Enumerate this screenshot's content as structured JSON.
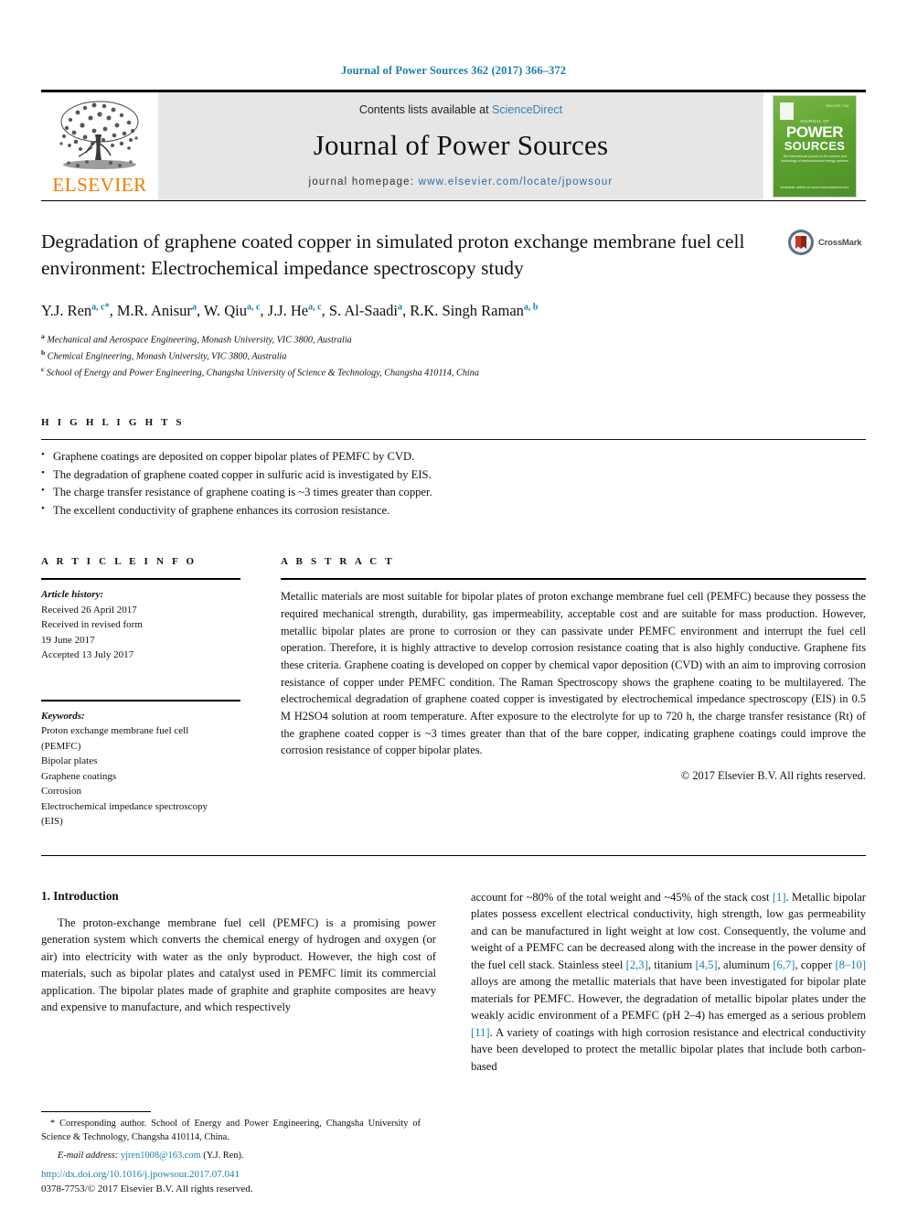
{
  "running_head": "Journal of Power Sources 362 (2017) 366–372",
  "masthead": {
    "publisher_name": "ELSEVIER",
    "contents_prefix": "Contents lists available at ",
    "contents_link": "ScienceDirect",
    "journal_name": "Journal of Power Sources",
    "homepage_prefix": "journal homepage: ",
    "homepage_url": "www.elsevier.com/locate/jpowsour",
    "cover": {
      "issn_line": "ISSN 0378-7753",
      "kicker": "JOURNAL OF",
      "word_power": "POWER",
      "word_sources": "SOURCES",
      "subtitle": "The international journal on the science and technology of electrochemical energy systems",
      "footer": "Available online at www.sciencedirect.com"
    }
  },
  "article": {
    "title": "Degradation of graphene coated copper in simulated proton exchange membrane fuel cell environment: Electrochemical impedance spectroscopy study",
    "crossmark_label": "CrossMark",
    "authors": [
      {
        "name": "Y.J. Ren",
        "marks": "a, c",
        "star": true
      },
      {
        "name": "M.R. Anisur",
        "marks": "a",
        "star": false
      },
      {
        "name": "W. Qiu",
        "marks": "a, c",
        "star": false
      },
      {
        "name": "J.J. He",
        "marks": "a, c",
        "star": false
      },
      {
        "name": "S. Al-Saadi",
        "marks": "a",
        "star": false
      },
      {
        "name": "R.K. Singh Raman",
        "marks": "a, b",
        "star": false
      }
    ],
    "affiliations": [
      {
        "mark": "a",
        "text": "Mechanical and Aerospace Engineering, Monash University, VIC 3800, Australia"
      },
      {
        "mark": "b",
        "text": "Chemical Engineering, Monash University, VIC 3800, Australia"
      },
      {
        "mark": "c",
        "text": "School of Energy and Power Engineering, Changsha University of Science & Technology, Changsha 410114, China"
      }
    ]
  },
  "highlights": {
    "heading": "H I G H L I G H T S",
    "items": [
      "Graphene coatings are deposited on copper bipolar plates of PEMFC by CVD.",
      "The degradation of graphene coated copper in sulfuric acid is investigated by EIS.",
      "The charge transfer resistance of graphene coating is ~3 times greater than copper.",
      "The excellent conductivity of graphene enhances its corrosion resistance."
    ]
  },
  "article_info": {
    "heading": "A R T I C L E  I N F O",
    "history_label": "Article history:",
    "history": [
      "Received 26 April 2017",
      "Received in revised form",
      "19 June 2017",
      "Accepted 13 July 2017"
    ],
    "keywords_label": "Keywords:",
    "keywords": [
      "Proton exchange membrane fuel cell",
      "(PEMFC)",
      "Bipolar plates",
      "Graphene coatings",
      "Corrosion",
      "Electrochemical impedance spectroscopy",
      "(EIS)"
    ]
  },
  "abstract": {
    "heading": "A B S T R A C T",
    "text": "Metallic materials are most suitable for bipolar plates of proton exchange membrane fuel cell (PEMFC) because they possess the required mechanical strength, durability, gas impermeability, acceptable cost and are suitable for mass production. However, metallic bipolar plates are prone to corrosion or they can passivate under PEMFC environment and interrupt the fuel cell operation. Therefore, it is highly attractive to develop corrosion resistance coating that is also highly conductive. Graphene fits these criteria. Graphene coating is developed on copper by chemical vapor deposition (CVD) with an aim to improving corrosion resistance of copper under PEMFC condition. The Raman Spectroscopy shows the graphene coating to be multilayered. The electrochemical degradation of graphene coated copper is investigated by electrochemical impedance spectroscopy (EIS) in 0.5 M H2SO4 solution at room temperature. After exposure to the electrolyte for up to 720 h, the charge transfer resistance (Rt) of the graphene coated copper is ~3 times greater than that of the bare copper, indicating graphene coatings could improve the corrosion resistance of copper bipolar plates.",
    "copyright": "© 2017 Elsevier B.V. All rights reserved."
  },
  "body": {
    "section_number_title": "1.  Introduction",
    "left_paragraph": "The proton-exchange membrane fuel cell (PEMFC) is a promising power generation system which converts the chemical energy of hydrogen and oxygen (or air) into electricity with water as the only byproduct. However, the high cost of materials, such as bipolar plates and catalyst used in PEMFC limit its commercial application. The bipolar plates made of graphite and graphite composites are heavy and expensive to manufacture, and which respectively",
    "right_paragraph_parts": [
      "account for ~80% of the total weight and ~45% of the stack cost ",
      "[1]",
      ". Metallic bipolar plates possess excellent electrical conductivity, high strength, low gas permeability and can be manufactured in light weight at low cost. Consequently, the volume and weight of a PEMFC can be decreased along with the increase in the power density of the fuel cell stack. Stainless steel ",
      "[2,3]",
      ", titanium ",
      "[4,5]",
      ", aluminum ",
      "[6,7]",
      ", copper ",
      "[8–10]",
      " alloys are among the metallic materials that have been investigated for bipolar plate materials for PEMFC. However, the degradation of metallic bipolar plates under the weakly acidic environment of a PEMFC (pH 2–4) has emerged as a serious problem ",
      "[11]",
      ". A variety of coatings with high corrosion resistance and electrical conductivity have been developed to protect the metallic bipolar plates that include both carbon-based"
    ]
  },
  "footer": {
    "corresponding_star": "*",
    "corresponding_text": " Corresponding author. School of Energy and Power Engineering, Changsha University of Science & Technology, Changsha 410114, China.",
    "email_label": "E-mail address:",
    "email": "yjren1008@163.com",
    "email_owner": "(Y.J. Ren).",
    "doi": "http://dx.doi.org/10.1016/j.jpowsour.2017.07.041",
    "issn_line": "0378-7753/© 2017 Elsevier B.V. All rights reserved."
  },
  "colors": {
    "link_blue": "#1b7fa8",
    "elsevier_orange": "#f07d00",
    "cover_green": "#5da32f"
  }
}
